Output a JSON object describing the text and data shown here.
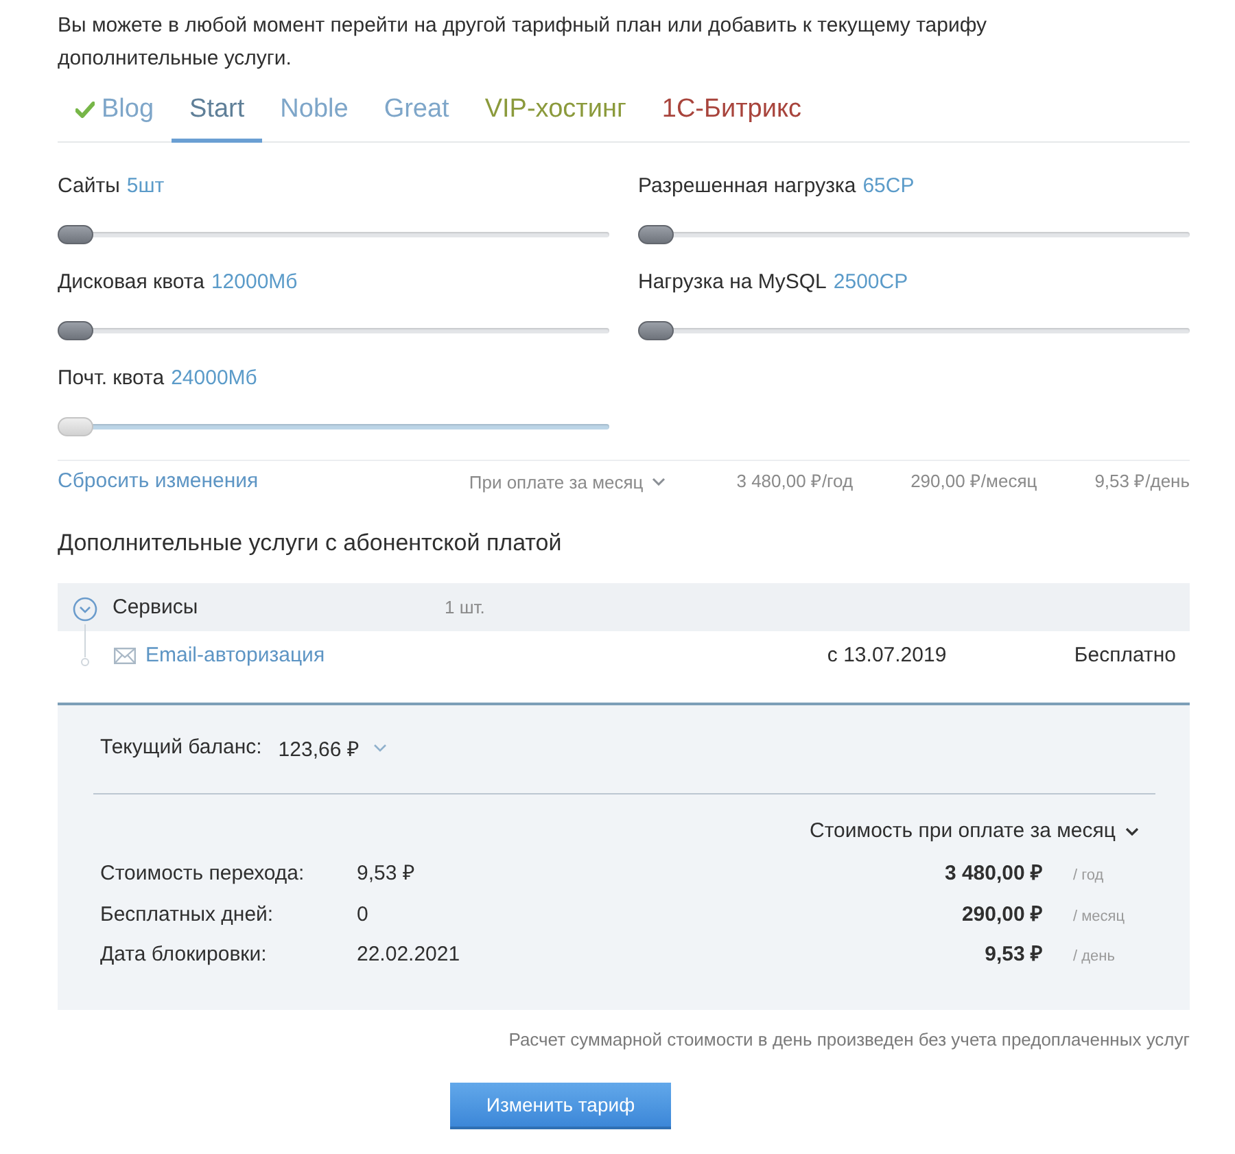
{
  "intro": "Вы можете в любой момент перейти на другой тарифный план или добавить к текущему тарифу дополнительные услуги.",
  "tabs": [
    {
      "label": "Blog",
      "selected": false,
      "current": true,
      "color": "#7ea6c9"
    },
    {
      "label": "Start",
      "selected": true,
      "current": false,
      "color": "#5f7f98"
    },
    {
      "label": "Noble",
      "selected": false,
      "current": false,
      "color": "#7ea6c9"
    },
    {
      "label": "Great",
      "selected": false,
      "current": false,
      "color": "#7ea6c9"
    },
    {
      "label": "VIP-хостинг",
      "selected": false,
      "current": false,
      "color": "#8b9a3c"
    },
    {
      "label": "1С-Битрикс",
      "selected": false,
      "current": false,
      "color": "#a8443c"
    }
  ],
  "sliders": [
    {
      "label": "Сайты",
      "value": "5шт",
      "level": 0,
      "disabled": false
    },
    {
      "label": "Разрешенная нагрузка",
      "value": "65CP",
      "level": 0,
      "disabled": false
    },
    {
      "label": "Дисковая квота",
      "value": "12000Мб",
      "level": 0,
      "disabled": false
    },
    {
      "label": "Нагрузка на MySQL",
      "value": "2500CP",
      "level": 0,
      "disabled": false
    },
    {
      "label": "Почт. квота",
      "value": "24000Мб",
      "level": 0,
      "disabled": true
    }
  ],
  "summary": {
    "reset_link": "Сбросить изменения",
    "period": "При оплате за месяц",
    "prices": [
      "3 480,00 ₽/год",
      "290,00 ₽/месяц",
      "9,53 ₽/день"
    ]
  },
  "services": {
    "heading": "Дополнительные услуги с абонентской платой",
    "groups": [
      {
        "name": "Сервисы",
        "count": "1 шт.",
        "expanded": true,
        "children": [
          {
            "name": "Email-авторизация",
            "since": "с 13.07.2019",
            "price": "Бесплатно"
          }
        ]
      }
    ]
  },
  "balance": {
    "label": "Текущий баланс:",
    "value": "123,66 ₽",
    "period": "Стоимость при оплате за месяц",
    "details": [
      {
        "label": "Стоимость перехода:",
        "value": "9,53 ₽"
      },
      {
        "label": "Бесплатных дней:",
        "value": "0"
      },
      {
        "label": "Дата блокировки:",
        "value": "22.02.2021"
      }
    ],
    "costs": [
      {
        "amount": "3 480,00 ₽",
        "unit": "/ год"
      },
      {
        "amount": "290,00 ₽",
        "unit": "/ месяц"
      },
      {
        "amount": "9,53 ₽",
        "unit": "/ день"
      }
    ]
  },
  "note": "Расчет суммарной стоимости в день произведен без учета предоплаченных услуг",
  "submit": "Изменить тариф"
}
